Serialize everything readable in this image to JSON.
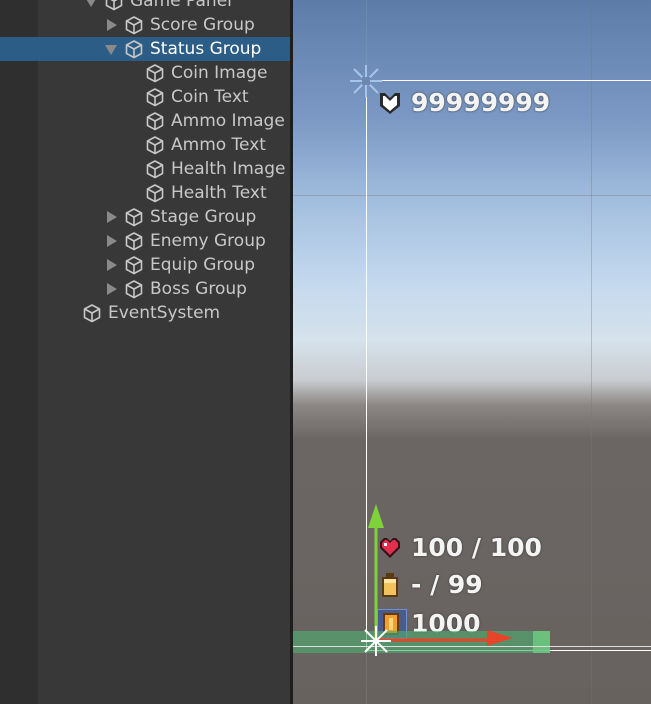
{
  "hierarchy": {
    "items": [
      {
        "label": "Game Panel",
        "indent": 0,
        "arrow": "down",
        "selected": false
      },
      {
        "label": "Score Group",
        "indent": 1,
        "arrow": "right",
        "selected": false
      },
      {
        "label": "Status Group",
        "indent": 1,
        "arrow": "down",
        "selected": true
      },
      {
        "label": "Coin Image",
        "indent": 2,
        "arrow": "none",
        "selected": false
      },
      {
        "label": "Coin Text",
        "indent": 2,
        "arrow": "none",
        "selected": false
      },
      {
        "label": "Ammo Image",
        "indent": 2,
        "arrow": "none",
        "selected": false
      },
      {
        "label": "Ammo Text",
        "indent": 2,
        "arrow": "none",
        "selected": false
      },
      {
        "label": "Health Image",
        "indent": 2,
        "arrow": "none",
        "selected": false
      },
      {
        "label": "Health Text",
        "indent": 2,
        "arrow": "none",
        "selected": false
      },
      {
        "label": "Stage Group",
        "indent": 1,
        "arrow": "right",
        "selected": false
      },
      {
        "label": "Enemy Group",
        "indent": 1,
        "arrow": "right",
        "selected": false
      },
      {
        "label": "Equip Group",
        "indent": 1,
        "arrow": "right",
        "selected": false
      },
      {
        "label": "Boss Group",
        "indent": 1,
        "arrow": "right",
        "selected": false
      },
      {
        "label": "EventSystem",
        "indent": -1,
        "arrow": "none",
        "selected": false
      }
    ]
  },
  "scene": {
    "score_text": "99999999",
    "health_text": "100 / 100",
    "ammo_text": "- / 99",
    "coin_text": "1000"
  },
  "colors": {
    "selection": "#2c5d87",
    "gizmo_y": "#7fd23a",
    "gizmo_x": "#e8442a",
    "health_icon": "#e03050",
    "ammo_icon": "#f2c35a",
    "coin_icon": "#f0a030"
  },
  "icons": [
    "gameobject-cube-icon",
    "expand-arrow-icon",
    "score-badge-icon",
    "heart-icon",
    "ammo-icon",
    "coin-icon",
    "move-gizmo-icon",
    "pivot-icon"
  ]
}
